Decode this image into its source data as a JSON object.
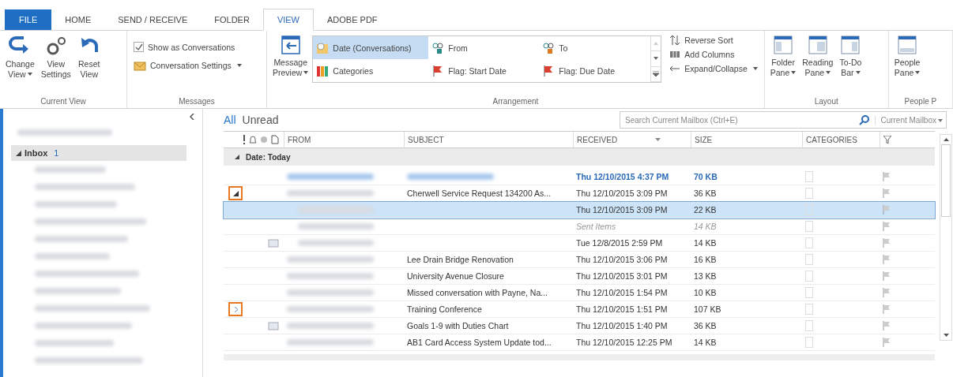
{
  "ribbon_tabs": [
    {
      "label": "FILE",
      "kind": "file",
      "selected": false
    },
    {
      "label": "HOME",
      "kind": "tab",
      "selected": false
    },
    {
      "label": "SEND / RECEIVE",
      "kind": "tab",
      "selected": false
    },
    {
      "label": "FOLDER",
      "kind": "tab",
      "selected": false
    },
    {
      "label": "VIEW",
      "kind": "tab",
      "selected": true
    },
    {
      "label": "ADOBE PDF",
      "kind": "tab",
      "selected": false
    }
  ],
  "current_view": {
    "label": "Current View",
    "buttons": [
      {
        "kind": "change",
        "lines": [
          "Change",
          "View"
        ],
        "caret": true
      },
      {
        "kind": "settings",
        "lines": [
          "View",
          "Settings"
        ],
        "caret": false
      },
      {
        "kind": "reset",
        "lines": [
          "Reset",
          "View"
        ],
        "caret": false
      }
    ]
  },
  "messages": {
    "label": "Messages",
    "show_as_conversations": {
      "label": "Show as Conversations",
      "checked": true
    },
    "conversation_settings": "Conversation Settings"
  },
  "arrangement": {
    "label": "Arrangement",
    "message_preview": [
      "Message",
      "Preview"
    ],
    "gallery": [
      {
        "label": "Date (Conversations)",
        "kind": "date",
        "selected": true
      },
      {
        "label": "From",
        "kind": "person",
        "selected": false
      },
      {
        "label": "To",
        "kind": "person-to",
        "selected": false
      },
      {
        "label": "Categories",
        "kind": "categories",
        "selected": false
      },
      {
        "label": "Flag: Start Date",
        "kind": "flag",
        "selected": false
      },
      {
        "label": "Flag: Due Date",
        "kind": "flag",
        "selected": false
      }
    ],
    "commands": [
      {
        "label": "Reverse Sort",
        "kind": "sort",
        "caret": false
      },
      {
        "label": "Add Columns",
        "kind": "columns",
        "caret": false
      },
      {
        "label": "Expand/Collapse",
        "kind": "expand",
        "caret": true
      }
    ]
  },
  "layout": {
    "label": "Layout",
    "buttons": [
      {
        "lines": [
          "Folder",
          "Pane"
        ]
      },
      {
        "lines": [
          "Reading",
          "Pane"
        ]
      },
      {
        "lines": [
          "To-Do",
          "Bar"
        ]
      }
    ]
  },
  "people": {
    "label": "People P",
    "lines": [
      "People",
      "Pane"
    ]
  },
  "sidebar": {
    "inbox": {
      "label": "Inbox",
      "count": "1",
      "expanded": true
    },
    "folders": [
      {
        "kind": "blurred"
      },
      {
        "kind": "blurred"
      },
      {
        "kind": "blurred"
      },
      {
        "kind": "blurred"
      },
      {
        "kind": "blurred"
      },
      {
        "kind": "blurred"
      },
      {
        "kind": "blurred"
      },
      {
        "kind": "blurred"
      },
      {
        "kind": "blurred"
      },
      {
        "kind": "blurred"
      },
      {
        "kind": "blurred"
      },
      {
        "kind": "blurred"
      }
    ]
  },
  "filters": [
    {
      "label": "All",
      "selected": true
    },
    {
      "label": "Unread",
      "selected": false
    }
  ],
  "search": {
    "placeholder": "Search Current Mailbox (Ctrl+E)",
    "scope": "Current Mailbox"
  },
  "columns": [
    "FROM",
    "SUBJECT",
    "RECEIVED",
    "SIZE",
    "CATEGORIES"
  ],
  "group": {
    "label": "Date: Today",
    "expanded": true
  },
  "rows": [
    {
      "kind": "message",
      "unread": true,
      "selected": false,
      "subject": "",
      "subject_blurred": true,
      "received": "Thu 12/10/2015 4:37 PM",
      "size": "70 KB"
    },
    {
      "kind": "conversation",
      "expanded": true,
      "unread": false,
      "selected": false,
      "subject": "Cherwell Service Request 134200 As...",
      "subject_blurred": false,
      "received": "Thu 12/10/2015 3:09 PM",
      "size": "36 KB"
    },
    {
      "kind": "child",
      "unread": false,
      "selected": true,
      "subject": "",
      "subject_blurred": false,
      "received": "Thu 12/10/2015 3:09 PM",
      "size": "22 KB"
    },
    {
      "kind": "child",
      "unread": false,
      "selected": false,
      "sent": true,
      "subject": "",
      "subject_blurred": false,
      "received": "Sent Items",
      "size": "14 KB"
    },
    {
      "kind": "child-ref",
      "unread": false,
      "selected": false,
      "subject": "",
      "subject_blurred": false,
      "received": "Tue 12/8/2015 2:59 PM",
      "size": "14 KB"
    },
    {
      "kind": "message",
      "unread": false,
      "selected": false,
      "subject": "Lee Drain Bridge Renovation",
      "subject_blurred": false,
      "received": "Thu 12/10/2015 3:06 PM",
      "size": "16 KB"
    },
    {
      "kind": "message",
      "unread": false,
      "selected": false,
      "subject": "University Avenue Closure",
      "subject_blurred": false,
      "received": "Thu 12/10/2015 3:01 PM",
      "size": "13 KB"
    },
    {
      "kind": "message",
      "unread": false,
      "selected": false,
      "subject": "Missed conversation with Payne, Na...",
      "subject_blurred": false,
      "received": "Thu 12/10/2015 1:54 PM",
      "size": "10 KB"
    },
    {
      "kind": "conversation",
      "expanded": false,
      "unread": false,
      "selected": false,
      "subject": "Training Conference",
      "subject_blurred": false,
      "received": "Thu 12/10/2015 1:51 PM",
      "size": "107 KB"
    },
    {
      "kind": "message-ref",
      "unread": false,
      "selected": false,
      "subject": "Goals 1-9 with Duties Chart",
      "subject_blurred": false,
      "received": "Thu 12/10/2015 1:40 PM",
      "size": "36 KB"
    },
    {
      "kind": "message",
      "unread": false,
      "selected": false,
      "subject": "AB1 Card Access System Update tod...",
      "subject_blurred": false,
      "received": "Thu 12/10/2015 12:25 PM",
      "size": "14 KB"
    }
  ]
}
